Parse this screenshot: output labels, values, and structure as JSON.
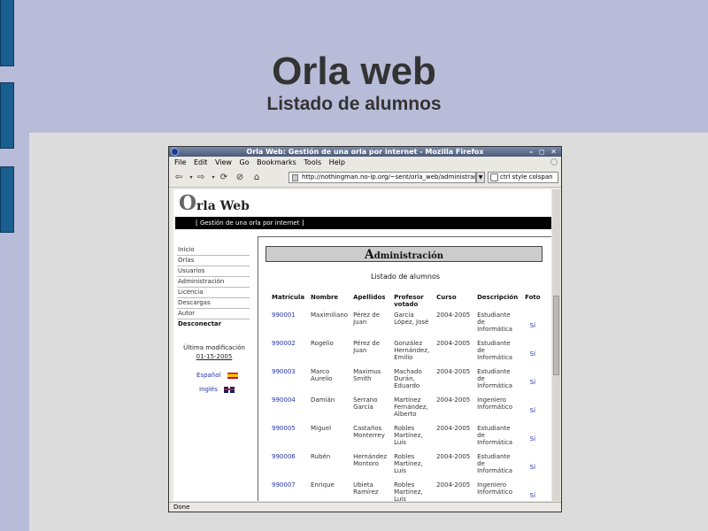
{
  "slide": {
    "title": "Orla web",
    "subtitle": "Listado de alumnos"
  },
  "browser": {
    "window_title": "Orla Web: Gestión de una orla por internet - Mozilla Firefox",
    "window_controls": "– ◻ ✕",
    "menu": [
      "File",
      "Edit",
      "View",
      "Go",
      "Bookmarks",
      "Tools",
      "Help"
    ],
    "url": "http://nothingman.no-ip.org/~sent/orla_web/administrac",
    "search": "ctrl style colspan",
    "status": "Done"
  },
  "site": {
    "logo_initial": "O",
    "logo_rest": "rla Web",
    "tagline": "[ Gestión de una orla por internet ]",
    "nav": [
      "Inicio",
      "Orlas",
      "Usuarios",
      "Administración",
      "Licencia",
      "Descargas",
      "Autor"
    ],
    "logout": "Desconectar",
    "last_modified_label": "Última modificación",
    "last_modified_date": "01-15-2005",
    "lang_es": "Español",
    "lang_en": "Inglés"
  },
  "admin": {
    "heading_initial": "A",
    "heading_rest": "dministración",
    "list_title": "Listado de alumnos",
    "columns": [
      "Matrícula",
      "Nombre",
      "Apellidos",
      "Profesor votado",
      "Curso",
      "Descripción",
      "Foto"
    ],
    "rows": [
      {
        "matricula": "990001",
        "nombre": "Maximiliano",
        "apellidos": "Pérez de Juan",
        "profesor": "García López, José",
        "curso": "2004-2005",
        "descripcion": "Estudiante de Informática",
        "foto": "Sí"
      },
      {
        "matricula": "990002",
        "nombre": "Rogelio",
        "apellidos": "Pérez de Juan",
        "profesor": "González Hernández, Emilio",
        "curso": "2004-2005",
        "descripcion": "Estudiante de Informática",
        "foto": "Sí"
      },
      {
        "matricula": "990003",
        "nombre": "Marco Aurelio",
        "apellidos": "Maximus Smith",
        "profesor": "Machado Durán, Eduardo",
        "curso": "2004-2005",
        "descripcion": "Estudiante de Informática",
        "foto": "Sí"
      },
      {
        "matricula": "990004",
        "nombre": "Damián",
        "apellidos": "Serrano García",
        "profesor": "Martínez Fernández, Alberto",
        "curso": "2004-2005",
        "descripcion": "Ingeniero Informático",
        "foto": "Sí"
      },
      {
        "matricula": "990005",
        "nombre": "Miguel",
        "apellidos": "Castaños Monterrey",
        "profesor": "Robles Martínez, Luis",
        "curso": "2004-2005",
        "descripcion": "Estudiante de Informática",
        "foto": "Sí"
      },
      {
        "matricula": "990006",
        "nombre": "Rubén",
        "apellidos": "Hernández Montoro",
        "profesor": "Robles Martínez, Luis",
        "curso": "2004-2005",
        "descripcion": "Estudiante de Informática",
        "foto": "Sí"
      },
      {
        "matricula": "990007",
        "nombre": "Enrique",
        "apellidos": "Ubieta Ramírez",
        "profesor": "Robles Martínez, Luis",
        "curso": "2004-2005",
        "descripcion": "Ingeniero Informático",
        "foto": "Sí"
      }
    ]
  }
}
